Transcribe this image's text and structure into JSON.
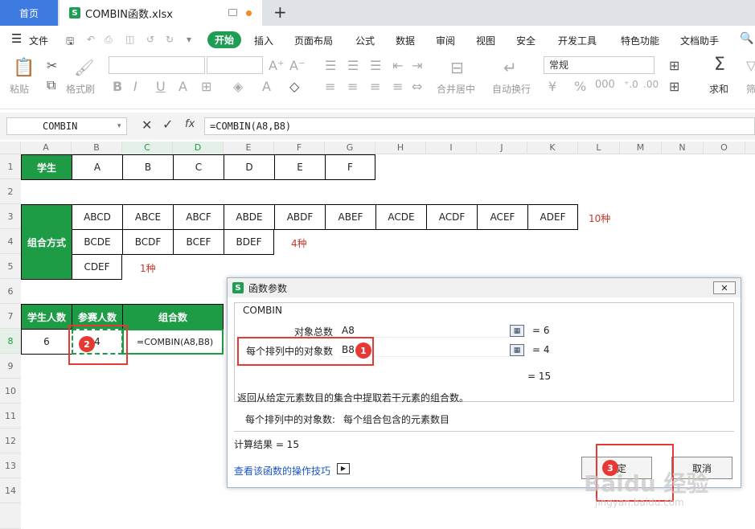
{
  "tabs": {
    "home": "首页",
    "file": "COMBIN函数.xlsx"
  },
  "menu": {
    "file": "文件",
    "items": [
      "开始",
      "插入",
      "页面布局",
      "公式",
      "数据",
      "审阅",
      "视图",
      "安全",
      "开发工具",
      "特色功能",
      "文档助手"
    ]
  },
  "ribbon": {
    "paste": "粘贴",
    "format_painter": "格式刷",
    "merge_center": "合并居中",
    "auto_wrap": "自动换行",
    "number_format": "常规",
    "sum": "求和",
    "filter": "筛"
  },
  "formula_bar": {
    "name_box": "COMBIN",
    "fx": "fx",
    "formula": "=COMBIN(A8,B8)"
  },
  "columns": [
    "A",
    "B",
    "C",
    "D",
    "E",
    "F",
    "G",
    "H",
    "I",
    "J",
    "K",
    "L",
    "M",
    "N",
    "O"
  ],
  "rows": [
    "1",
    "2",
    "3",
    "4",
    "5",
    "6",
    "7",
    "8",
    "9",
    "10",
    "11",
    "12",
    "13",
    "14"
  ],
  "sheet": {
    "r1": {
      "header": "学生",
      "vals": [
        "A",
        "B",
        "C",
        "D",
        "E",
        "F"
      ]
    },
    "group_label": "组合方式",
    "r3": [
      "ABCD",
      "ABCE",
      "ABCF",
      "ABDE",
      "ABDF",
      "ABEF",
      "ACDE",
      "ACDF",
      "ACEF",
      "ADEF"
    ],
    "r3_note": "10种",
    "r4": [
      "BCDE",
      "BCDF",
      "BCEF",
      "BDEF"
    ],
    "r4_note": "4种",
    "r5": [
      "CDEF"
    ],
    "r5_note": "1种",
    "r7": [
      "学生人数",
      "参赛人数",
      "组合数"
    ],
    "r8": [
      "6",
      "4",
      "=COMBIN(A8,B8)"
    ]
  },
  "badges": [
    "1",
    "2",
    "3"
  ],
  "dialog": {
    "title": "函数参数",
    "close": "✕",
    "func": "COMBIN",
    "arg1_label": "对象总数",
    "arg1_value": "A8",
    "arg1_result": "= 6",
    "arg2_label": "每个排列中的对象数",
    "arg2_value": "B8",
    "arg2_result": "= 4",
    "total_result": "= 15",
    "description": "返回从给定元素数目的集合中提取若干元素的组合数。",
    "arg_help_label": "每个排列中的对象数:",
    "arg_help_text": "每个组合包含的元素数目",
    "calc_result": "计算结果 = 15",
    "tips_link": "查看该函数的操作技巧",
    "ok": "确定",
    "cancel": "取消"
  },
  "watermark": {
    "main": "Baidu 经验",
    "sub": "jingyan.baidu.com"
  },
  "colors": {
    "accent": "#1f9d55",
    "header_green": "#1e9b45",
    "highlight": "#e53935",
    "tab_blue": "#3d7be0"
  }
}
